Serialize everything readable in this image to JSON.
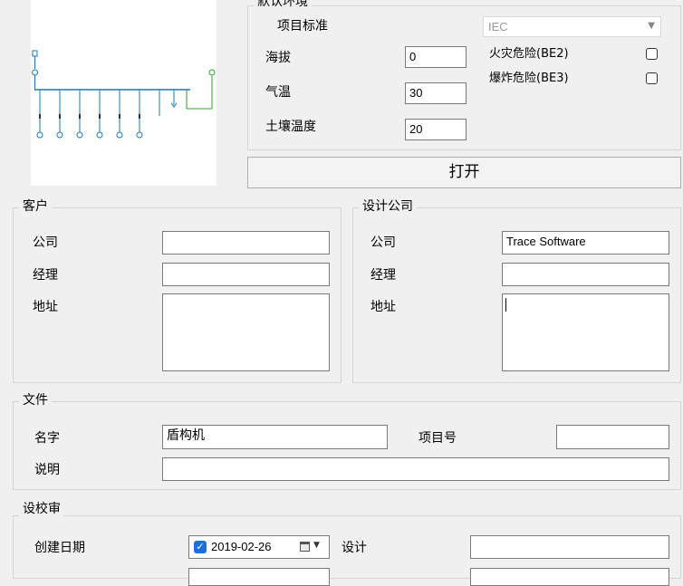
{
  "env": {
    "group_title": "默认环境",
    "standard_label": "项目标准",
    "standard_value": "IEC",
    "altitude_label": "海拔",
    "altitude_value": "0",
    "temperature_label": "气温",
    "temperature_value": "30",
    "soil_temp_label": "土壤温度",
    "soil_temp_value": "20",
    "fire_label": "火灾危险(BE2)",
    "explosion_label": "爆炸危险(BE3)",
    "fire_checked": false,
    "explosion_checked": false
  },
  "open_button": "打开",
  "client": {
    "title": "客户",
    "company_label": "公司",
    "company_value": "",
    "manager_label": "经理",
    "manager_value": "",
    "address_label": "地址",
    "address_value": ""
  },
  "design": {
    "title": "设计公司",
    "company_label": "公司",
    "company_value": "Trace Software",
    "manager_label": "经理",
    "manager_value": "",
    "address_label": "地址",
    "address_value": ""
  },
  "file": {
    "title": "文件",
    "name_label": "名字",
    "name_value": "盾构机",
    "project_no_label": "项目号",
    "project_no_value": "",
    "desc_label": "说明",
    "desc_value": ""
  },
  "review": {
    "title": "设校审",
    "created_label": "创建日期",
    "created_value": "2019-02-26",
    "created_checked": true,
    "design_label": "设计",
    "design_value": ""
  },
  "colors": {
    "diagram_line": "#1f77b4",
    "diagram_green": "#2ca02c",
    "check_blue": "#1e6fd9"
  }
}
